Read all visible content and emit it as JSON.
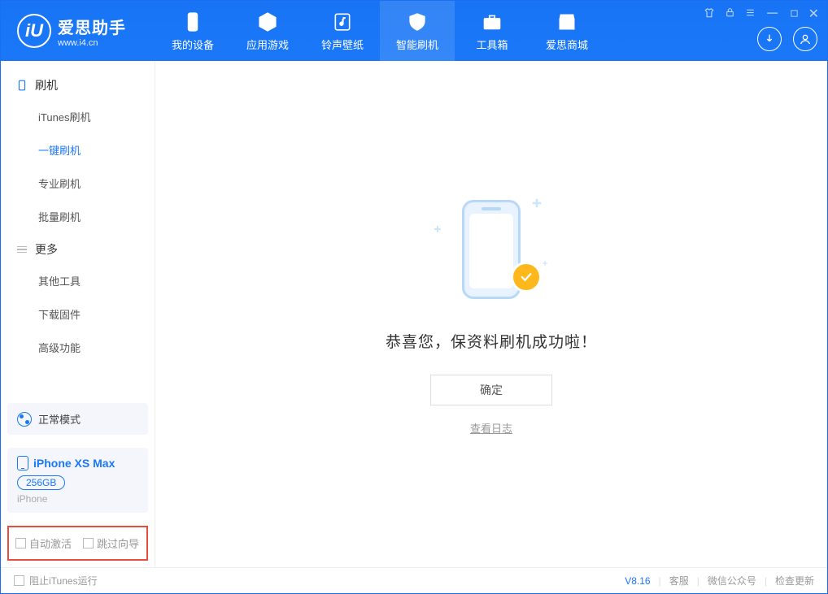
{
  "app": {
    "title": "爱思助手",
    "subtitle": "www.i4.cn"
  },
  "tabs": {
    "device": "我的设备",
    "apps": "应用游戏",
    "ringtone": "铃声壁纸",
    "flash": "智能刷机",
    "toolbox": "工具箱",
    "store": "爱思商城"
  },
  "sidebar": {
    "group1": {
      "title": "刷机",
      "items": [
        "iTunes刷机",
        "一键刷机",
        "专业刷机",
        "批量刷机"
      ]
    },
    "group2": {
      "title": "更多",
      "items": [
        "其他工具",
        "下载固件",
        "高级功能"
      ]
    }
  },
  "device_panel": {
    "mode": "正常模式",
    "name": "iPhone XS Max",
    "capacity": "256GB",
    "type": "iPhone"
  },
  "options": {
    "auto_activate": "自动激活",
    "skip_guide": "跳过向导"
  },
  "main": {
    "success_title": "恭喜您，保资料刷机成功啦！",
    "ok": "确定",
    "view_log": "查看日志"
  },
  "footer": {
    "block_itunes": "阻止iTunes运行",
    "version": "V8.16",
    "service": "客服",
    "wechat": "微信公众号",
    "update": "检查更新"
  }
}
